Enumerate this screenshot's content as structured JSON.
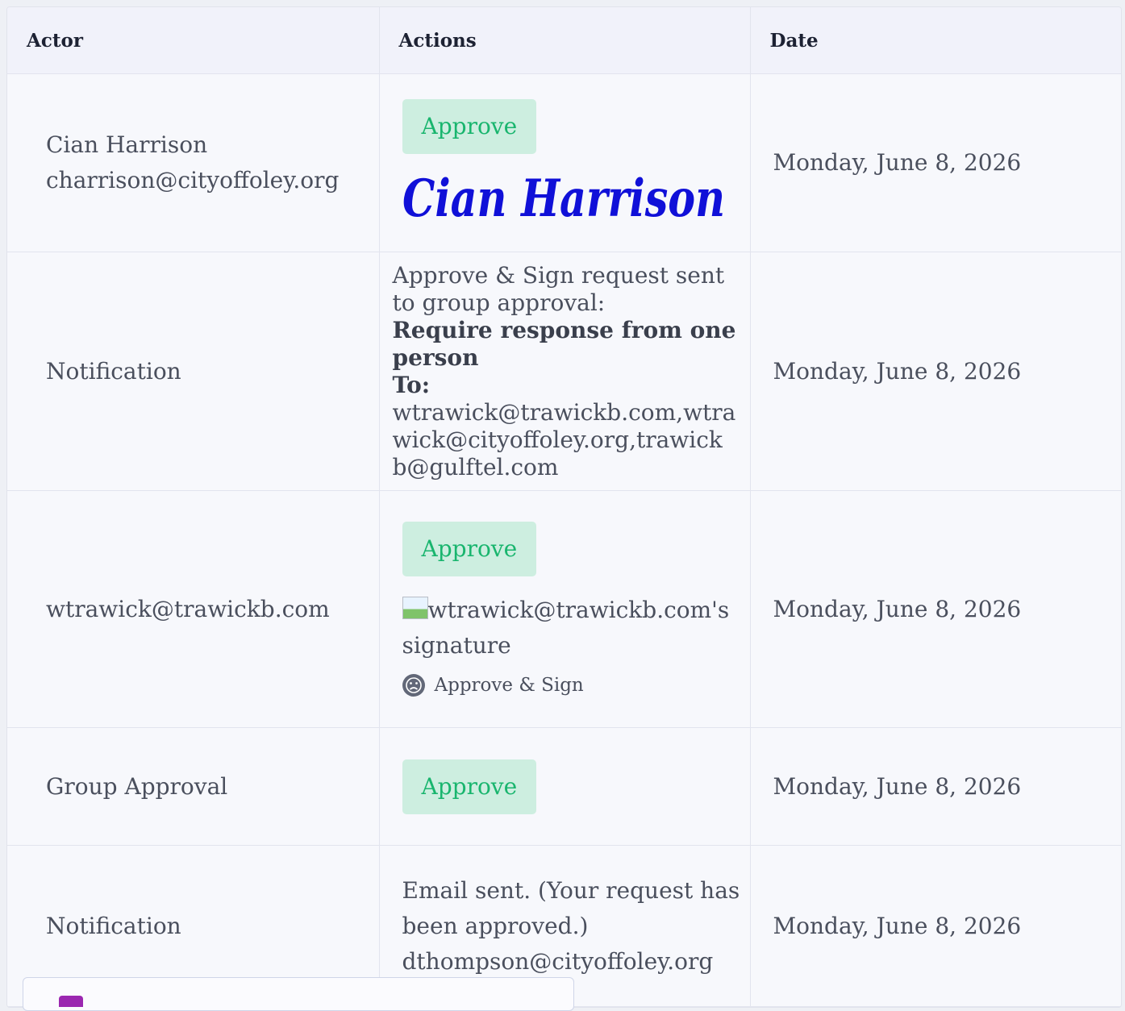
{
  "headers": {
    "actor": "Actor",
    "actions": "Actions",
    "date": "Date"
  },
  "rows": [
    {
      "actor_name": "Cian Harrison",
      "actor_email": "charrison@cityoffoley.org",
      "action_button": "Approve",
      "signature_text": "Cian Harrison",
      "date": "Monday, June 8, 2026"
    },
    {
      "actor": "Notification",
      "line1": "Approve & Sign request sent to group approval:",
      "line2": "Require response from one person",
      "to_label": "To:",
      "recipients": "wtrawick@trawickb.com,wtrawick@cityoffoley.org,trawickb@gulftel.com",
      "date": "Monday, June 8, 2026"
    },
    {
      "actor": "wtrawick@trawickb.com",
      "action_button": "Approve",
      "signature_alt": "wtrawick@trawickb.com's signature",
      "approve_sign_label": "Approve & Sign",
      "date": "Monday, June 8, 2026"
    },
    {
      "actor": "Group Approval",
      "action_button": "Approve",
      "date": "Monday, June 8, 2026"
    },
    {
      "actor": "Notification",
      "message": "Email sent. (Your request has been approved.)",
      "recipient": "dthompson@cityoffoley.org",
      "date": "Monday, June 8, 2026"
    }
  ],
  "colors": {
    "approve_bg": "#cdeee0",
    "approve_text": "#19b56e",
    "signature": "#1010d8"
  }
}
